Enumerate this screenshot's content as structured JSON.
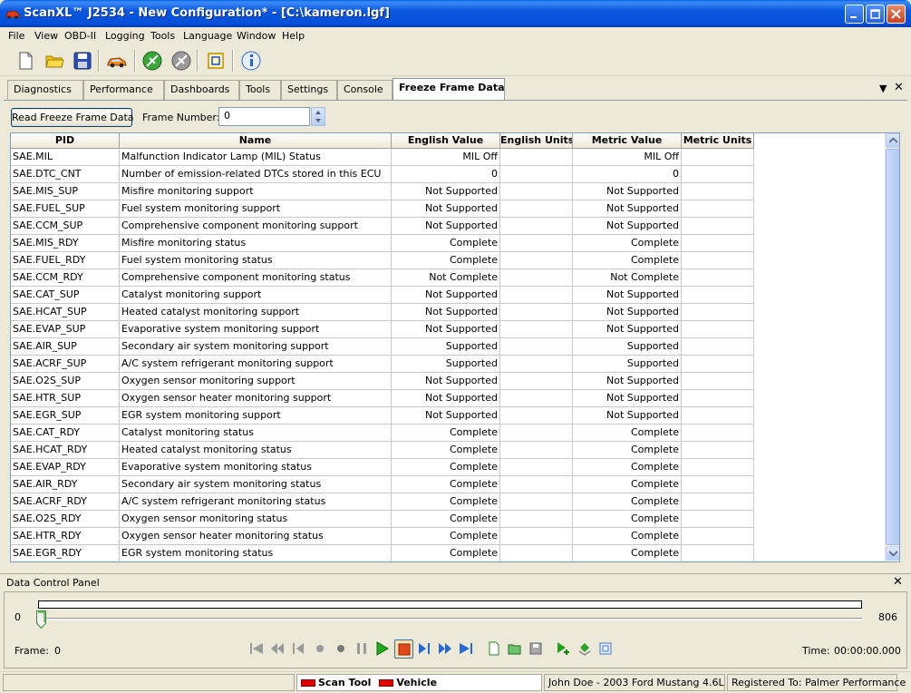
{
  "window": {
    "title": "ScanXL™ J2534 - New Configuration* - [C:\\kameron.lgf]"
  },
  "menu": [
    "File",
    "View",
    "OBD-II",
    "Logging",
    "Tools",
    "Language",
    "Window",
    "Help"
  ],
  "toolbar_icons": [
    "new-file-icon",
    "open-folder-icon",
    "save-icon",
    "vehicle-icon",
    "connect-icon",
    "disconnect-icon",
    "capture-icon",
    "info-icon"
  ],
  "tabs": [
    "Diagnostics",
    "Performance",
    "Dashboards",
    "Tools",
    "Settings",
    "Console",
    "Freeze Frame Data"
  ],
  "active_tab": "Freeze Frame Data",
  "controls": {
    "read_button": "Read Freeze Frame Data",
    "frame_label": "Frame Number:",
    "frame_value": "0"
  },
  "table": {
    "columns": [
      "PID",
      "Name",
      "English Value",
      "English Units",
      "Metric Value",
      "Metric Units"
    ],
    "rows": [
      [
        "SAE.MIL",
        "Malfunction Indicator Lamp (MIL) Status",
        "MIL Off",
        "",
        "MIL Off",
        ""
      ],
      [
        "SAE.DTC_CNT",
        "Number of emission-related DTCs stored in this ECU",
        "0",
        "",
        "0",
        ""
      ],
      [
        "SAE.MIS_SUP",
        "Misfire monitoring support",
        "Not Supported",
        "",
        "Not Supported",
        ""
      ],
      [
        "SAE.FUEL_SUP",
        "Fuel system monitoring support",
        "Not Supported",
        "",
        "Not Supported",
        ""
      ],
      [
        "SAE.CCM_SUP",
        "Comprehensive component monitoring support",
        "Not Supported",
        "",
        "Not Supported",
        ""
      ],
      [
        "SAE.MIS_RDY",
        "Misfire monitoring status",
        "Complete",
        "",
        "Complete",
        ""
      ],
      [
        "SAE.FUEL_RDY",
        "Fuel system monitoring status",
        "Complete",
        "",
        "Complete",
        ""
      ],
      [
        "SAE.CCM_RDY",
        "Comprehensive component monitoring status",
        "Not Complete",
        "",
        "Not Complete",
        ""
      ],
      [
        "SAE.CAT_SUP",
        "Catalyst monitoring support",
        "Not Supported",
        "",
        "Not Supported",
        ""
      ],
      [
        "SAE.HCAT_SUP",
        "Heated catalyst monitoring support",
        "Not Supported",
        "",
        "Not Supported",
        ""
      ],
      [
        "SAE.EVAP_SUP",
        "Evaporative system monitoring support",
        "Not Supported",
        "",
        "Not Supported",
        ""
      ],
      [
        "SAE.AIR_SUP",
        "Secondary air system monitoring support",
        "Supported",
        "",
        "Supported",
        ""
      ],
      [
        "SAE.ACRF_SUP",
        "A/C system refrigerant monitoring support",
        "Supported",
        "",
        "Supported",
        ""
      ],
      [
        "SAE.O2S_SUP",
        "Oxygen sensor monitoring support",
        "Not Supported",
        "",
        "Not Supported",
        ""
      ],
      [
        "SAE.HTR_SUP",
        "Oxygen sensor heater monitoring support",
        "Not Supported",
        "",
        "Not Supported",
        ""
      ],
      [
        "SAE.EGR_SUP",
        "EGR system monitoring support",
        "Not Supported",
        "",
        "Not Supported",
        ""
      ],
      [
        "SAE.CAT_RDY",
        "Catalyst monitoring status",
        "Complete",
        "",
        "Complete",
        ""
      ],
      [
        "SAE.HCAT_RDY",
        "Heated catalyst monitoring status",
        "Complete",
        "",
        "Complete",
        ""
      ],
      [
        "SAE.EVAP_RDY",
        "Evaporative system monitoring status",
        "Complete",
        "",
        "Complete",
        ""
      ],
      [
        "SAE.AIR_RDY",
        "Secondary air system monitoring status",
        "Complete",
        "",
        "Complete",
        ""
      ],
      [
        "SAE.ACRF_RDY",
        "A/C system refrigerant monitoring status",
        "Complete",
        "",
        "Complete",
        ""
      ],
      [
        "SAE.O2S_RDY",
        "Oxygen sensor monitoring status",
        "Complete",
        "",
        "Complete",
        ""
      ],
      [
        "SAE.HTR_RDY",
        "Oxygen sensor heater monitoring status",
        "Complete",
        "",
        "Complete",
        ""
      ],
      [
        "SAE.EGR_RDY",
        "EGR system monitoring status",
        "Complete",
        "",
        "Complete",
        ""
      ]
    ]
  },
  "data_control_panel": {
    "title": "Data Control Panel",
    "range_min": "0",
    "range_max": "806",
    "frame_label": "Frame:",
    "frame_value": "0",
    "time_label": "Time:",
    "time_value": "00:00:00.000",
    "playback_icons": [
      "first-icon",
      "rewind-fast-icon",
      "step-back-icon",
      "stop-dot-icon",
      "record-dot-icon",
      "pause-icon",
      "play-icon",
      "stop-icon",
      "step-forward-icon",
      "fast-forward-icon",
      "last-icon",
      "new-log-icon",
      "open-log-icon",
      "save-log-icon",
      "add-marker-icon",
      "export-icon",
      "snapshot-icon"
    ]
  },
  "status": {
    "scan_tool": "Scan Tool",
    "vehicle": "Vehicle",
    "vehicle_info": "John Doe - 2003 Ford Mustang 4.6L",
    "registered": "Registered To: Palmer Performance"
  },
  "colors": {
    "title_bar": "#0a58e0",
    "face": "#ece9d8",
    "led_red": "#e00000"
  }
}
